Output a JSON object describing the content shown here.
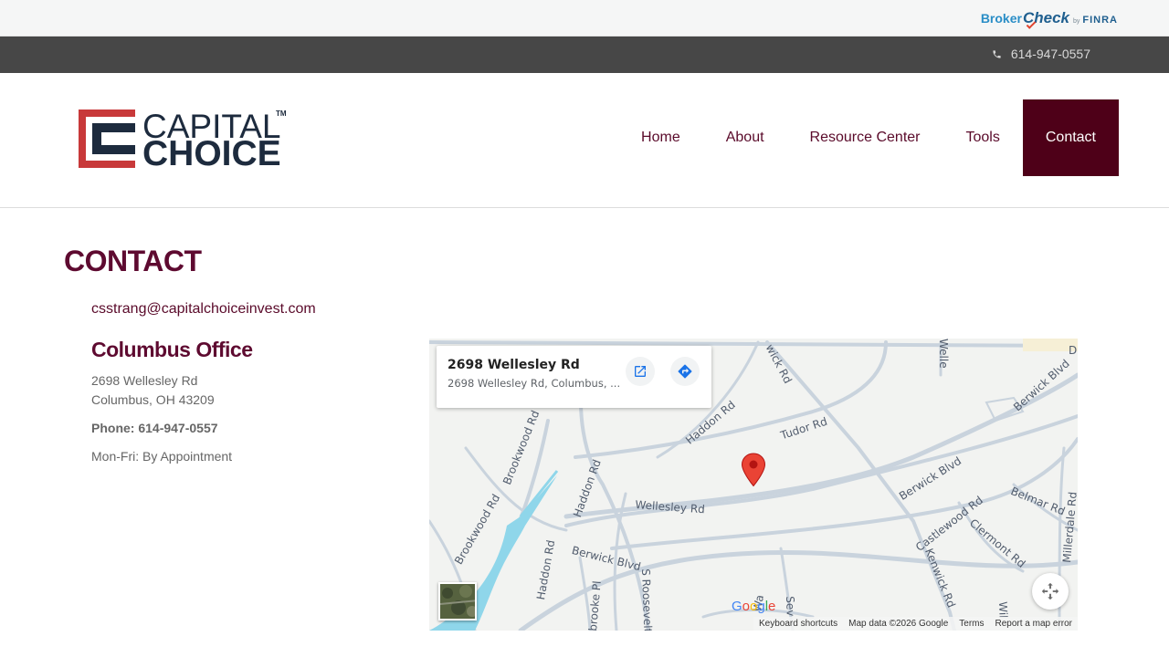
{
  "top_strip": {
    "brokercheck": {
      "broker": "Broker",
      "check": "Check",
      "by": "by",
      "finra": "FINRA"
    }
  },
  "phone_bar": {
    "phone": "614-947-0557",
    "icon": "phone-icon"
  },
  "header": {
    "logo": {
      "line1": "CAPITAL",
      "tm": "TM",
      "line2": "CHOICE",
      "colors": {
        "red": "#c8393a",
        "navy": "#1d2b3e"
      }
    },
    "nav": [
      {
        "label": "Home"
      },
      {
        "label": "About"
      },
      {
        "label": "Resource Center"
      },
      {
        "label": "Tools"
      },
      {
        "label": "Contact",
        "active": true
      }
    ]
  },
  "main": {
    "title": "CONTACT",
    "email": "csstrang@capitalchoiceinvest.com",
    "office": {
      "title": "Columbus Office",
      "address_line1": "2698 Wellesley Rd",
      "address_line2": "Columbus, OH 43209",
      "phone": "Phone: 614-947-0557",
      "hours": "Mon-Fri: By Appointment"
    }
  },
  "map": {
    "card": {
      "title": "2698 Wellesley Rd",
      "subtitle": "2698 Wellesley Rd, Columbus, ..."
    },
    "street_labels": {
      "wellesley": "Wellesley Rd",
      "tudor": "Tudor Rd",
      "haddon1": "Haddon Rd",
      "haddon2": "Haddon Rd",
      "haddon3": "Haddon Rd",
      "berwick1": "Berwick Blvd",
      "berwick2": "Berwick Blvd",
      "berwick3": "Berwick Blvd",
      "brookwood1": "Brookwood Rd",
      "brookwood2": "Brookwood Rd",
      "brookwood3": "Brookwood Rd",
      "castlewood": "Castlewood Rd",
      "kenwick": "Kenwick Rd",
      "clermont": "Clermont Rd",
      "belmar": "Belmar Rd",
      "millerdale": "Millerdale Rd",
      "roosevelt": "S Roosevelt",
      "brooke": "brooke Pl",
      "nwick": "wick Rd",
      "welle": "Welle",
      "d": "D",
      "sev": "Sev",
      "wa": "Wa",
      "wil": "Wil"
    },
    "google": "Google",
    "attribution": [
      "Keyboard shortcuts",
      "Map data ©2026 Google",
      "Terms",
      "Report a map error"
    ],
    "colors": {
      "road": "#c9d3dd",
      "water": "#8fd6ea",
      "bg": "#f2f3f1",
      "pin": "#ea4335"
    }
  }
}
